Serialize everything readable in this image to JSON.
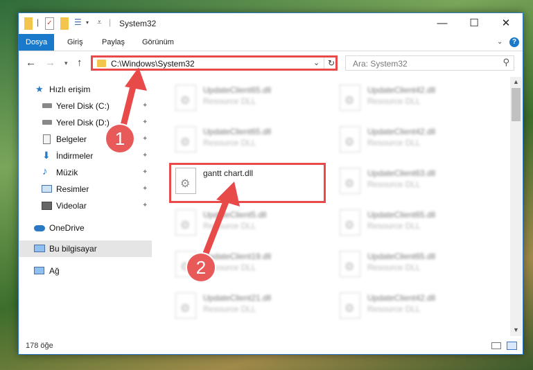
{
  "window": {
    "title": "System32",
    "controls": {
      "minimize": "—",
      "maximize": "☐",
      "close": "✕"
    }
  },
  "ribbon": {
    "tabs": [
      {
        "label": "Dosya",
        "active": true
      },
      {
        "label": "Giriş"
      },
      {
        "label": "Paylaş"
      },
      {
        "label": "Görünüm"
      }
    ],
    "help": "?"
  },
  "nav": {
    "address": "C:\\Windows\\System32",
    "search_placeholder": "Ara: System32"
  },
  "sidebar": {
    "items": [
      {
        "label": "Hızlı erişim",
        "icon": "star-icon"
      },
      {
        "label": "Yerel Disk (C:)",
        "icon": "drive-icon",
        "pinned": true
      },
      {
        "label": "Yerel Disk (D:)",
        "icon": "drive-icon",
        "pinned": true
      },
      {
        "label": "Belgeler",
        "icon": "documents-icon",
        "pinned": true
      },
      {
        "label": "İndirmeler",
        "icon": "download-icon",
        "pinned": true
      },
      {
        "label": "Müzik",
        "icon": "music-icon",
        "pinned": true
      },
      {
        "label": "Resimler",
        "icon": "pictures-icon",
        "pinned": true
      },
      {
        "label": "Videolar",
        "icon": "videos-icon",
        "pinned": true
      },
      {
        "label": "OneDrive",
        "icon": "cloud-icon"
      },
      {
        "label": "Bu bilgisayar",
        "icon": "computer-icon",
        "selected": true
      },
      {
        "label": "Ağ",
        "icon": "network-icon"
      }
    ]
  },
  "files": {
    "left": [
      {
        "name": "UpdateClient65.dll",
        "type": "Resource DLL"
      },
      {
        "name": "UpdateClient65.dll",
        "type": "Resource DLL"
      },
      {
        "name": "gantt chart.dll",
        "type": ""
      },
      {
        "name": "UpdateClient5.dll",
        "type": "Resource DLL"
      },
      {
        "name": "UpdateClient19.dll",
        "type": "Resource DLL"
      },
      {
        "name": "UpdateClient21.dll",
        "type": "Resource DLL"
      }
    ],
    "right": [
      {
        "name": "UpdateClient42.dll",
        "type": "Resource DLL"
      },
      {
        "name": "UpdateClient42.dll",
        "type": "Resource DLL"
      },
      {
        "name": "UpdateClient63.dll",
        "type": "Resource DLL"
      },
      {
        "name": "UpdateClient65.dll",
        "type": "Resource DLL"
      },
      {
        "name": "UpdateClient65.dll",
        "type": "Resource DLL"
      },
      {
        "name": "UpdateClient42.dll",
        "type": "Resource DLL"
      }
    ]
  },
  "status": {
    "count": "178 öğe"
  },
  "annotations": {
    "badge1": "1",
    "badge2": "2",
    "color": "#e84a4a"
  }
}
